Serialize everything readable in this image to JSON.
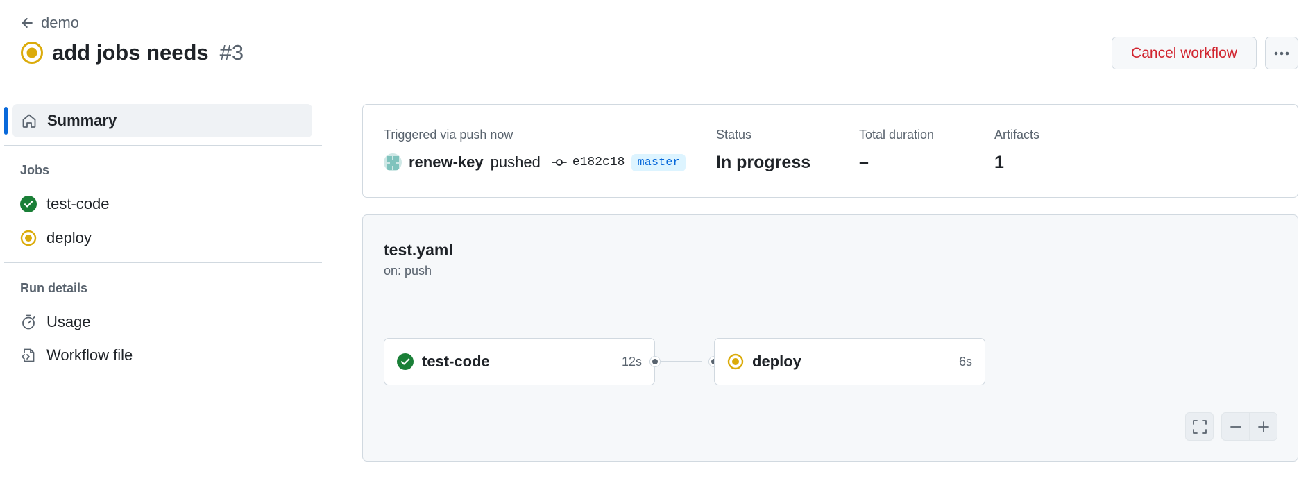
{
  "header": {
    "back_label": "demo",
    "title": "add jobs needs",
    "run_number": "#3",
    "cancel_label": "Cancel workflow"
  },
  "sidebar": {
    "summary_label": "Summary",
    "jobs_heading": "Jobs",
    "jobs": [
      {
        "label": "test-code",
        "status": "success"
      },
      {
        "label": "deploy",
        "status": "in-progress"
      }
    ],
    "run_details_heading": "Run details",
    "run_details": [
      {
        "label": "Usage",
        "icon": "stopwatch-icon"
      },
      {
        "label": "Workflow file",
        "icon": "file-code-icon"
      }
    ]
  },
  "summary": {
    "trigger_text": "Triggered via push now",
    "actor": "renew-key",
    "action": "pushed",
    "commit": "e182c18",
    "branch": "master",
    "status_label": "Status",
    "status_value": "In progress",
    "duration_label": "Total duration",
    "duration_value": "–",
    "artifacts_label": "Artifacts",
    "artifacts_value": "1"
  },
  "graph": {
    "workflow_file": "test.yaml",
    "trigger": "on: push",
    "jobs": [
      {
        "name": "test-code",
        "duration": "12s",
        "status": "success"
      },
      {
        "name": "deploy",
        "duration": "6s",
        "status": "in-progress"
      }
    ]
  },
  "colors": {
    "success": "#1a7f37",
    "in_progress": "#dbab0a",
    "danger": "#d1242f",
    "accent": "#0969da"
  }
}
